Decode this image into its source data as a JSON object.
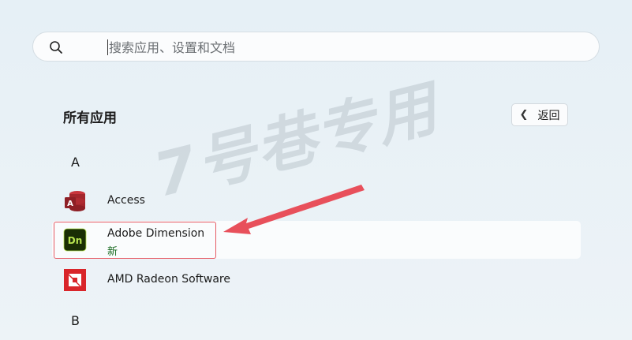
{
  "search": {
    "placeholder": "搜索应用、设置和文档",
    "value": ""
  },
  "section": {
    "title": "所有应用"
  },
  "back_button": {
    "label": "返回"
  },
  "groups": [
    {
      "letter": "A"
    },
    {
      "letter": "B"
    }
  ],
  "apps": [
    {
      "name": "Access",
      "badge": "",
      "icon": "access-icon"
    },
    {
      "name": "Adobe Dimension",
      "badge": "新",
      "icon": "adobe-dimension-icon"
    },
    {
      "name": "AMD Radeon Software",
      "badge": "",
      "icon": "amd-radeon-icon"
    }
  ],
  "watermark": {
    "text": "7号巷专用"
  },
  "colors": {
    "accent_red": "#e65a63",
    "new_badge": "#1a6b22",
    "dimension_green": "#b7e34f",
    "access_red": "#a4262c",
    "amd_red": "#d9252a"
  }
}
